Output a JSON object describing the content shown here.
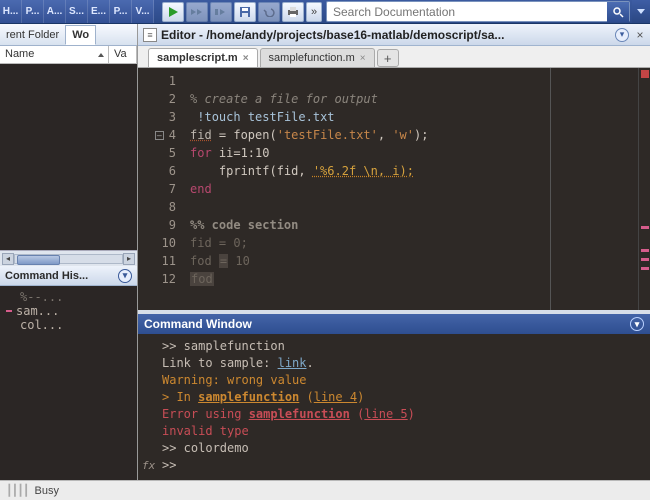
{
  "toolbar": {
    "tabs": [
      "H...",
      "P...",
      "A...",
      "S...",
      "E...",
      "P...",
      "V..."
    ],
    "search_placeholder": "Search Documentation"
  },
  "folder": {
    "tab_inactive": "rent Folder",
    "tab_active": "Wo",
    "col_name": "Name",
    "col_value": "Va"
  },
  "history": {
    "title": "Command His...",
    "items": [
      "%--...",
      "sam...",
      "col..."
    ]
  },
  "editor": {
    "title": "Editor - /home/andy/projects/base16-matlab/demoscript/sa...",
    "tabs": [
      {
        "label": "samplescript.m",
        "active": true
      },
      {
        "label": "samplefunction.m",
        "active": false
      }
    ],
    "lines": {
      "l1": "% create a file for output",
      "l2a": "!",
      "l2b": "touch testFile.txt",
      "l3a": "fid",
      "l3b": " = fopen(",
      "l3c": "'testFile.txt'",
      "l3d": ", ",
      "l3e": "'w'",
      "l3f": ");",
      "l4a": "for ",
      "l4b": "ii=1:10",
      "l5a": "    fprintf(fid, ",
      "l5b": "'%6.2f \\n, i);",
      "l6": "end",
      "l8": "%% code section",
      "l9": "fid = 0;",
      "l10a": "fod ",
      "l10b": "=",
      "l10c": " 10",
      "l11": "fod"
    }
  },
  "cmdwin": {
    "title": "Command Window",
    "l1": ">> samplefunction",
    "l2a": "Link to sample: ",
    "l2b": "link",
    "l2c": ".",
    "l3": "Warning: wrong value",
    "l4a": "> In ",
    "l4b": "samplefunction",
    "l4c": " (",
    "l4d": "line 4",
    "l4e": ")",
    "l5a": "Error using ",
    "l5b": "samplefunction",
    "l5c": " (",
    "l5d": "line 5",
    "l5e": ")",
    "l6": "invalid type",
    "l7": ">> colordemo",
    "l8": ">>"
  },
  "status": {
    "text": "Busy"
  }
}
